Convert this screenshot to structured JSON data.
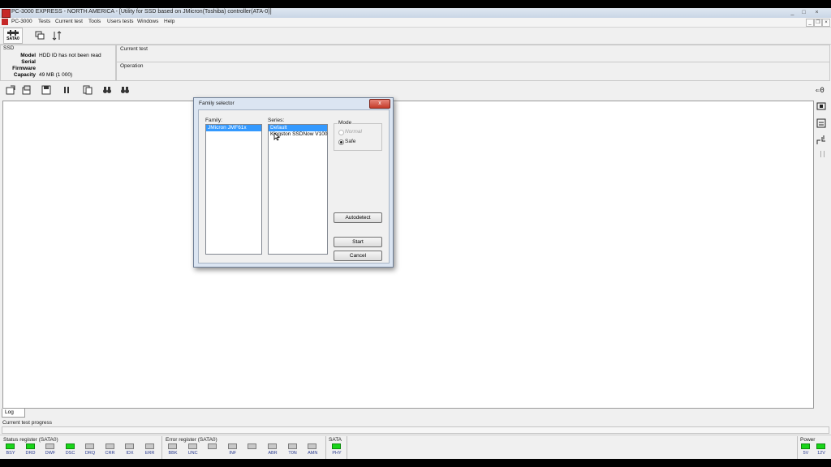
{
  "window": {
    "title": "PC-3000 EXPRESS - NORTH AMERICA - [Utility for SSD based on JMicron(Toshiba) controller(ATA-0)]",
    "min_glyph": "_",
    "max_glyph": "□",
    "close_glyph": "×"
  },
  "menu": {
    "items": [
      "PC-3000",
      "Tests",
      "Current test",
      "Tools",
      "Users tests",
      "Windows",
      "Help"
    ],
    "mdi_min": "_",
    "mdi_restore": "❐",
    "mdi_close": "×"
  },
  "toolbar1": {
    "port_label": "SATA0"
  },
  "ssd": {
    "section_label": "SSD",
    "model_label": "Model",
    "model_value": "HDD ID has not been read",
    "serial_label": "Serial",
    "serial_value": "",
    "firmware_label": "Firmware",
    "firmware_value": "",
    "capacity_label": "Capacity",
    "capacity_value": "49 MB (1 000)"
  },
  "current_test": {
    "label": "Current test"
  },
  "operation": {
    "label": "Operation"
  },
  "dialog": {
    "title": "Family selector",
    "close_glyph": "x",
    "family_label": "Family:",
    "family_items": [
      "JMicron JMF61x"
    ],
    "series_label": "Series:",
    "series_items": [
      "Default",
      "Kingston SSDNow V100"
    ],
    "mode_label": "Mode",
    "mode_normal": "Normal",
    "mode_safe": "Safe",
    "autodetect_button": "Autodetect",
    "start_button": "Start",
    "cancel_button": "Cancel"
  },
  "log": {
    "tab_label": "Log"
  },
  "progress": {
    "label": "Current test progress"
  },
  "status_register": {
    "label": "Status register (SATA0)",
    "leds": [
      {
        "name": "BSY",
        "on": true
      },
      {
        "name": "DRD",
        "on": true
      },
      {
        "name": "DWF",
        "on": false
      },
      {
        "name": "DSC",
        "on": true
      },
      {
        "name": "DRQ",
        "on": false
      },
      {
        "name": "CRR",
        "on": false
      },
      {
        "name": "IDX",
        "on": false
      },
      {
        "name": "ERR",
        "on": false
      }
    ]
  },
  "error_register": {
    "label": "Error register (SATA0)",
    "leds": [
      {
        "name": "BBK",
        "on": false
      },
      {
        "name": "UNC",
        "on": false
      },
      {
        "name": "",
        "on": false
      },
      {
        "name": "INF",
        "on": false
      },
      {
        "name": "",
        "on": false
      },
      {
        "name": "ABR",
        "on": false
      },
      {
        "name": "T0N",
        "on": false
      },
      {
        "name": "AMN",
        "on": false
      }
    ]
  },
  "sata": {
    "label": "SATA",
    "leds": [
      {
        "name": "PHY",
        "on": true
      }
    ]
  },
  "power": {
    "label": "Power",
    "leds": [
      {
        "name": "5V",
        "on": true
      },
      {
        "name": "12V",
        "on": true
      }
    ]
  },
  "colors": {
    "led_on": "#19d419",
    "led_off": "#c8c8c8",
    "selection": "#3399ff"
  }
}
